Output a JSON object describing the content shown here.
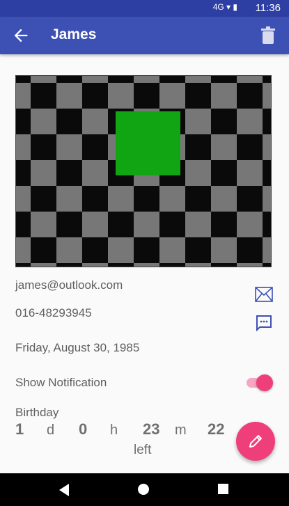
{
  "status_bar": {
    "icons": "4G ▾ ▮",
    "time": "11:36"
  },
  "app_bar": {
    "title": "James"
  },
  "contact": {
    "email": "james@outlook.com",
    "phone": "016-48293945",
    "birthday_date": "Friday, August 30, 1985",
    "show_notification_label": "Show Notification",
    "show_notification_on": true
  },
  "countdown": {
    "label": "Birthday",
    "days_value": "1",
    "days_unit": "d",
    "hours_value": "0",
    "hours_unit": "h",
    "minutes_value": "23",
    "minutes_unit": "m",
    "seconds_value": "22",
    "left_label": "left"
  },
  "colors": {
    "app_bar": "#3d51b5",
    "accent": "#ef3f7a",
    "icon_blue": "#3d51b5",
    "photo_green": "#11a514"
  },
  "icons": {
    "back": "arrow-left",
    "delete": "trash",
    "email": "envelope",
    "sms": "message",
    "fab": "pencil"
  }
}
